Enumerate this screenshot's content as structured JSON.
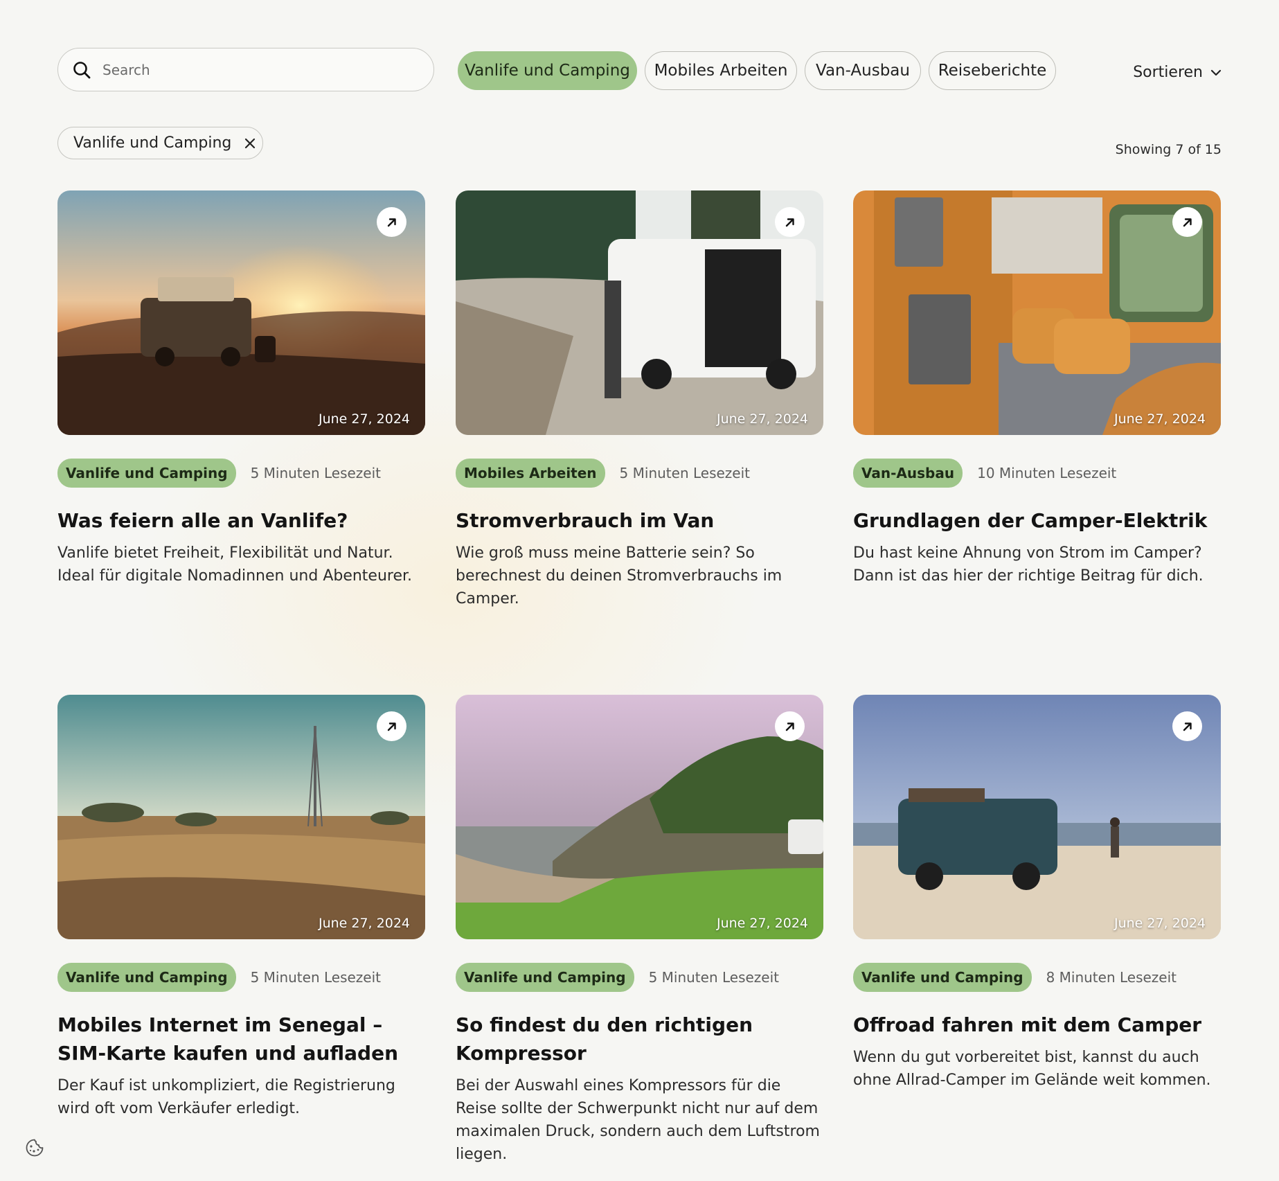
{
  "search": {
    "placeholder": "Search"
  },
  "categories": [
    "Vanlife und Camping",
    "Mobiles Arbeiten",
    "Van-Ausbau",
    "Reiseberichte"
  ],
  "active_category_index": 0,
  "sort": {
    "label": "Sortieren"
  },
  "active_filter": {
    "label": "Vanlife und Camping"
  },
  "result_count": "Showing 7 of 15",
  "colors": {
    "accent": "#9fc68a",
    "background": "#f6f6f3"
  },
  "cards": [
    {
      "date": "June 27, 2024",
      "tag": "Vanlife und Camping",
      "read_time": "5 Minuten Lesezeit",
      "title": "Was feiern alle an Vanlife?",
      "excerpt": "Vanlife bietet Freiheit, Flexibilität und Natur. Ideal für digitale Nomadinnen und Abenteurer."
    },
    {
      "date": "June 27, 2024",
      "tag": "Mobiles Arbeiten",
      "read_time": "5 Minuten Lesezeit",
      "title": "Stromverbrauch im Van",
      "excerpt": "Wie groß muss meine Batterie sein? So berechnest du deinen Stromverbrauchs im Camper."
    },
    {
      "date": "June 27, 2024",
      "tag": "Van-Ausbau",
      "read_time": "10 Minuten Lesezeit",
      "title": "Grundlagen der Camper-Elektrik",
      "excerpt": "Du hast keine Ahnung von Strom im Camper? Dann ist das hier der richtige Beitrag für dich."
    },
    {
      "date": "June 27, 2024",
      "tag": "Vanlife und Camping",
      "read_time": "5 Minuten Lesezeit",
      "title": "Mobiles Internet im Senegal – SIM-Karte kaufen und aufladen",
      "excerpt": "Der Kauf ist unkompliziert, die Registrierung wird oft vom Verkäufer erledigt."
    },
    {
      "date": "June 27, 2024",
      "tag": "Vanlife und Camping",
      "read_time": "5 Minuten Lesezeit",
      "title": "So findest du den richtigen Kompressor",
      "excerpt": "Bei der Auswahl eines Kompressors für die Reise sollte der Schwerpunkt nicht nur auf dem maximalen Druck, sondern auch dem Luftstrom liegen."
    },
    {
      "date": "June 27, 2024",
      "tag": "Vanlife und Camping",
      "read_time": "8 Minuten Lesezeit",
      "title": "Offroad fahren mit dem Camper",
      "excerpt": "Wenn du gut vorbereitet bist, kannst du auch ohne Allrad-Camper im Gelände weit kommen."
    }
  ]
}
